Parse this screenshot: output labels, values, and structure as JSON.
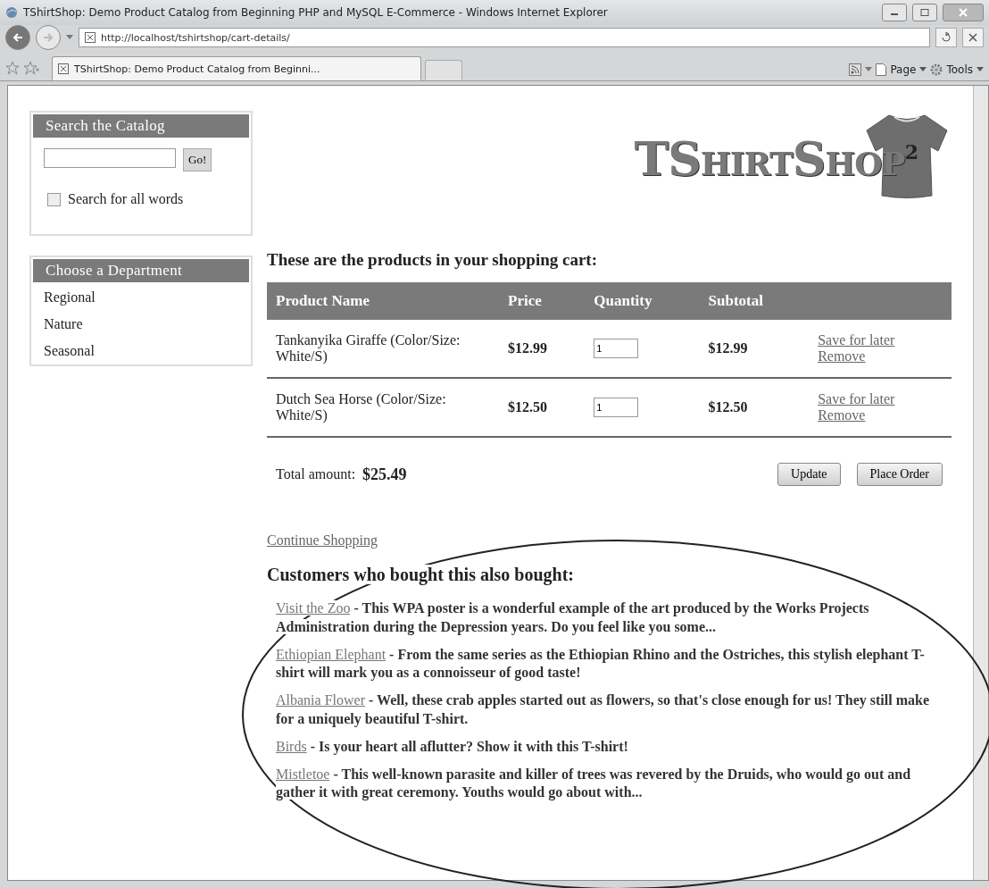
{
  "window": {
    "title": "TShirtShop: Demo Product Catalog from Beginning PHP and MySQL E-Commerce - Windows Internet Explorer"
  },
  "address_bar": {
    "url": "http://localhost/tshirtshop/cart-details/"
  },
  "tabs": [
    {
      "label": "TShirtShop: Demo Product Catalog from Beginni...",
      "selected": true
    }
  ],
  "command_bar": [
    "Page",
    "Tools"
  ],
  "search_box": {
    "title": "Search the Catalog",
    "button": "Go!",
    "all_words": {
      "label": "Search for all words",
      "checked": false
    }
  },
  "departments": {
    "title": "Choose a Department",
    "items": [
      "Regional",
      "Nature",
      "Seasonal"
    ]
  },
  "logo": {
    "text": "TShirtShop",
    "superscript": "2"
  },
  "cart": {
    "heading": "These are the products in your shopping cart:",
    "columns": [
      "Product Name",
      "Price",
      "Quantity",
      "Subtotal"
    ],
    "rows": [
      {
        "name": "Tankanyika Giraffe (Color/Size: White/S)",
        "price": "$12.99",
        "quantity": "1",
        "subtotal": "$12.99",
        "actions": [
          "Save for later",
          "Remove"
        ]
      },
      {
        "name": "Dutch Sea Horse (Color/Size: White/S)",
        "price": "$12.50",
        "quantity": "1",
        "subtotal": "$12.50",
        "actions": [
          "Save for later",
          "Remove"
        ]
      }
    ],
    "total_label": "Total amount:",
    "total": "$25.49",
    "buttons": [
      "Update",
      "Place Order"
    ]
  },
  "continue_link": "Continue Shopping",
  "recommendations": {
    "heading": "Customers who bought this also bought:",
    "items": [
      {
        "name": "Visit the Zoo",
        "description": " - This WPA poster is a wonderful example of the art produced by the Works Projects Administration during the Depression years. Do you feel like you some..."
      },
      {
        "name": "Ethiopian Elephant",
        "description": " - From the same series as the Ethiopian Rhino and the Ostriches, this stylish elephant T-shirt will mark you as a connoisseur of good taste!"
      },
      {
        "name": "Albania Flower",
        "description": " - Well, these crab apples started out as flowers, so that's close enough for us! They still make for a uniquely beautiful T-shirt."
      },
      {
        "name": "Birds",
        "description": " - Is your heart all aflutter? Show it with this T-shirt!"
      },
      {
        "name": "Mistletoe",
        "description": " - This well-known parasite and killer of trees was revered by the Druids, who would go out and gather it with great ceremony. Youths would go about with..."
      }
    ]
  }
}
